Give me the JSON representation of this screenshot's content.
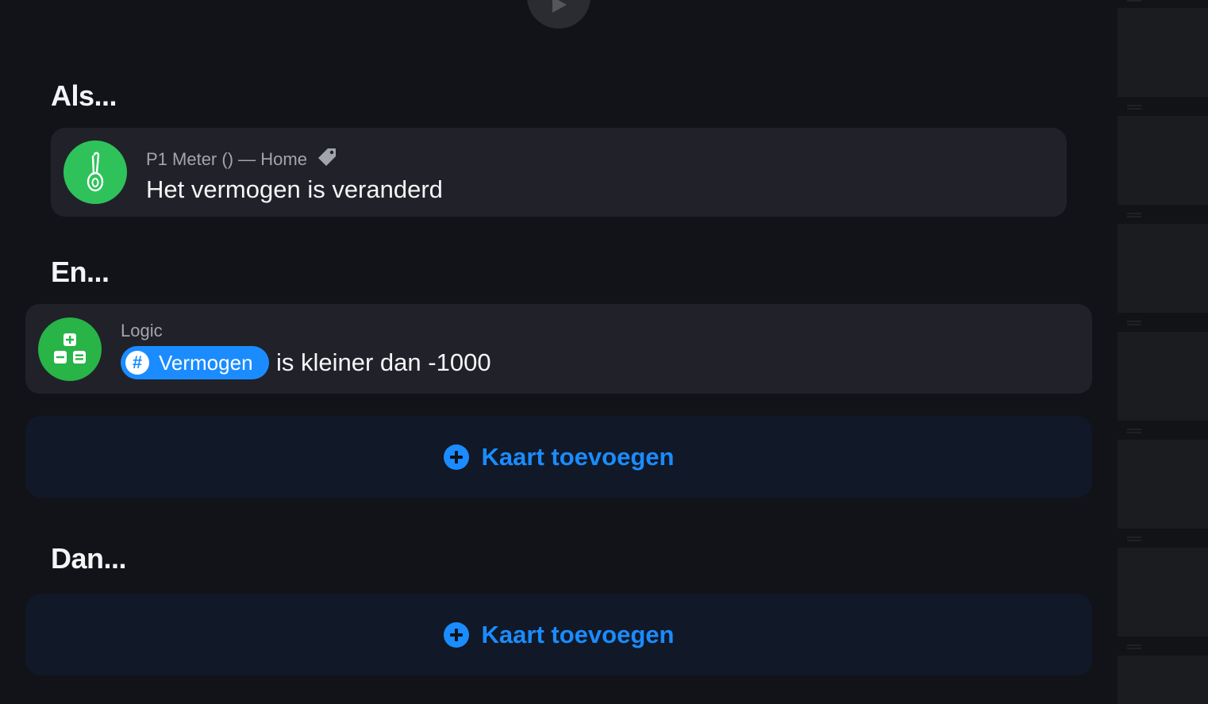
{
  "flow": {
    "when": {
      "title": "Als...",
      "card": {
        "device": "P1 Meter () — Home",
        "trigger": "Het vermogen is veranderd",
        "icon": "p1-meter-icon",
        "icon_color": "#2fc25b",
        "tag_icon": "tag-icon"
      }
    },
    "and": {
      "title": "En...",
      "card": {
        "source": "Logic",
        "token_label": "Vermogen",
        "token_icon": "hash-icon",
        "condition": "is kleiner dan -1000",
        "icon": "logic-calculator-icon",
        "icon_color": "#28b446"
      },
      "add_label": "Kaart toevoegen"
    },
    "then": {
      "title": "Dan...",
      "add_label": "Kaart toevoegen"
    }
  },
  "colors": {
    "accent": "#1a8cff",
    "background": "#121318",
    "card": "#212229",
    "add_card": "#111827"
  }
}
